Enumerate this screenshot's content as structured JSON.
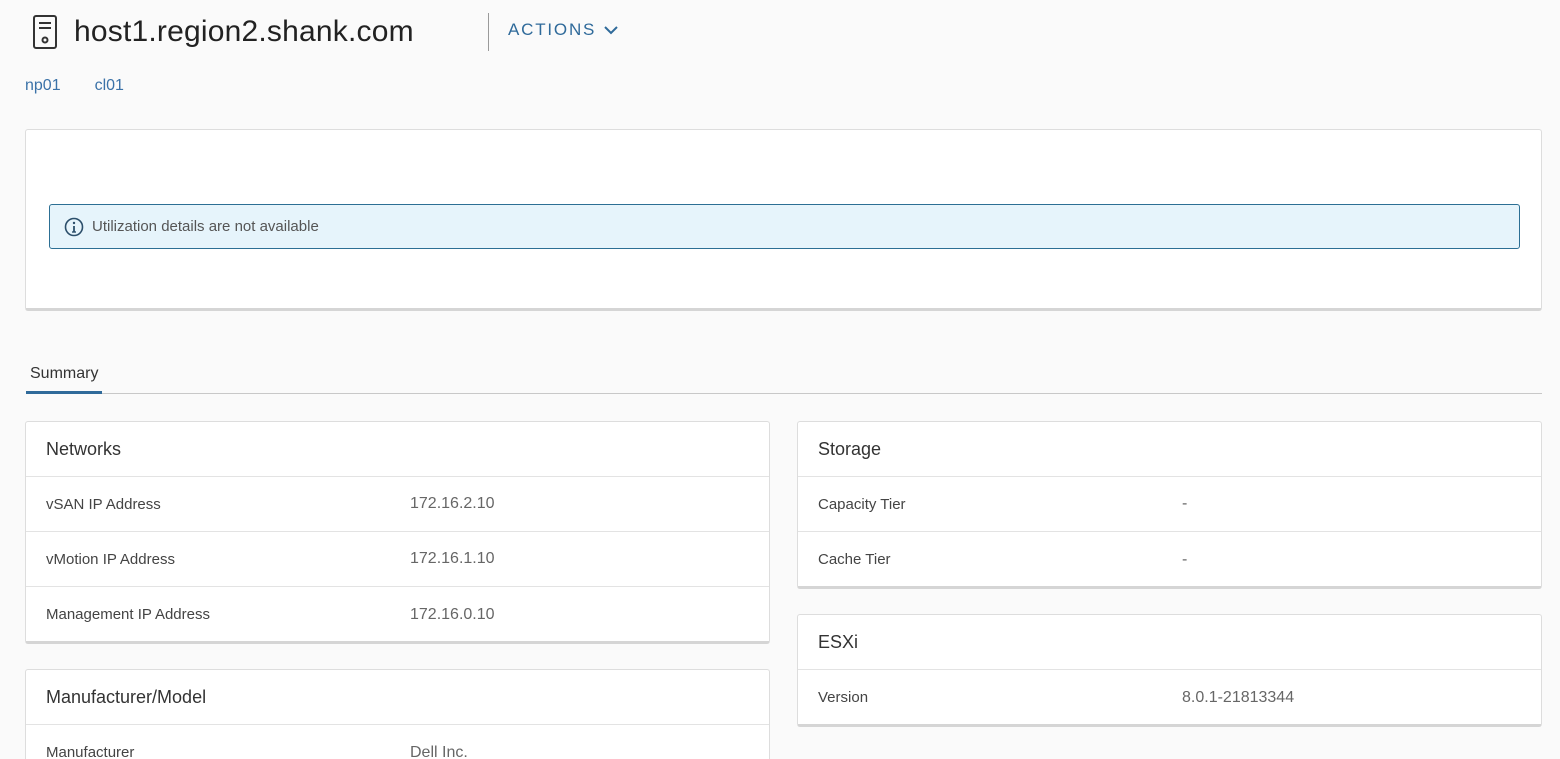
{
  "header": {
    "host_name": "host1.region2.shank.com",
    "icon": "server-host-icon",
    "actions_label": "ACTIONS"
  },
  "breadcrumb": [
    "np01",
    "cl01"
  ],
  "utilization": {
    "message": "Utilization details are not available",
    "icon": "info-circle-icon"
  },
  "tabs": [
    {
      "label": "Summary",
      "active": true
    }
  ],
  "networks": {
    "title": "Networks",
    "rows": [
      {
        "label": "vSAN IP Address",
        "value": "172.16.2.10"
      },
      {
        "label": "vMotion IP Address",
        "value": "172.16.1.10"
      },
      {
        "label": "Management IP Address",
        "value": "172.16.0.10"
      }
    ]
  },
  "manufacturer_model": {
    "title": "Manufacturer/Model",
    "rows": [
      {
        "label": "Manufacturer",
        "value": "Dell Inc."
      }
    ]
  },
  "storage": {
    "title": "Storage",
    "rows": [
      {
        "label": "Capacity Tier",
        "value": "-"
      },
      {
        "label": "Cache Tier",
        "value": "-"
      }
    ]
  },
  "esxi": {
    "title": "ESXi",
    "rows": [
      {
        "label": "Version",
        "value": "8.0.1-21813344"
      }
    ]
  },
  "colors": {
    "accent": "#2f6a9a",
    "link": "#3b72a8",
    "alert_bg": "#e6f4fb",
    "alert_border": "#2c6f94"
  }
}
